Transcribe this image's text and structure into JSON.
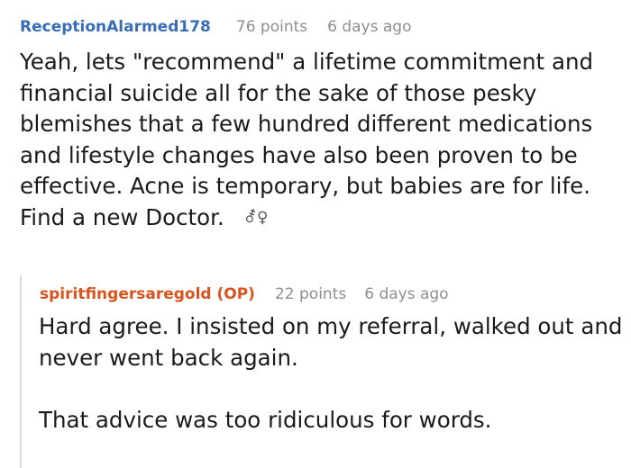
{
  "comment": {
    "username": "ReceptionAlarmed178",
    "points": "76 points",
    "time": "6 days ago",
    "body": "Yeah, lets \"recommend\" a lifetime commitment and financial suicide all for the sake of those pesky blemishes that a few hundred different medications and lifestyle changes have also been proven to be effective. Acne is temporary, but babies are for life. Find a new Doctor.",
    "gender_icon": "⚦♀"
  },
  "reply": {
    "username": "spiritfingersaregold (OP)",
    "points": "22 points",
    "time": "6 days ago",
    "paragraph_1": "Hard agree. I insisted on my referral, walked out and never went back again.",
    "paragraph_2": "That advice was too ridiculous for words."
  },
  "colors": {
    "username_blue": "#3a6db5",
    "username_op_orange": "#d9531e",
    "meta_gray": "#8e8e8e",
    "text": "#1a1a1a",
    "thread_line": "#dadada"
  }
}
